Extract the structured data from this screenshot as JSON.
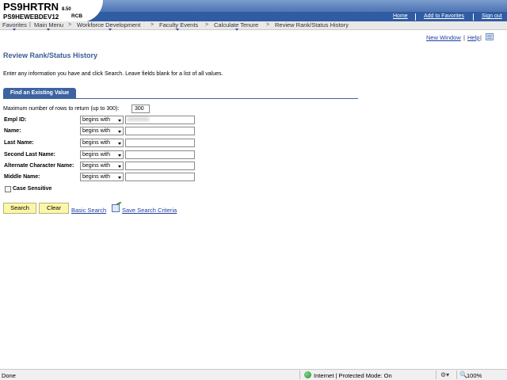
{
  "header": {
    "system": "PS9HRTRN",
    "version": "8.50",
    "database": "PS9HEWEBDEV12",
    "user": "RCB",
    "links": [
      "Home",
      "Add to Favorites",
      "Sign out"
    ]
  },
  "nav": {
    "items": [
      "Favorites",
      "Main Menu",
      "Workforce Development",
      "Faculty Events",
      "Calculate Tenure",
      "Review Rank/Status History"
    ],
    "separator": ">"
  },
  "page_links": {
    "new_window": "New Window",
    "help": "Help"
  },
  "page": {
    "title": "Review Rank/Status History",
    "instructions": "Enter any information you have and click Search. Leave fields blank for a list of all values.",
    "tab": "Find an Existing Value",
    "max_rows_label": "Maximum number of rows to return (up to 300):",
    "max_rows_value": "300"
  },
  "fields": [
    {
      "label": "Empl ID:",
      "operator": "begins with",
      "value": "0000000"
    },
    {
      "label": "Name:",
      "operator": "begins with",
      "value": ""
    },
    {
      "label": "Last Name:",
      "operator": "begins with",
      "value": ""
    },
    {
      "label": "Second Last Name:",
      "operator": "begins with",
      "value": ""
    },
    {
      "label": "Alternate Character Name:",
      "operator": "begins with",
      "value": ""
    },
    {
      "label": "Middle Name:",
      "operator": "begins with",
      "value": ""
    }
  ],
  "case_sensitive_label": "Case Sensitive",
  "buttons": {
    "search": "Search",
    "clear": "Clear",
    "basic_search": "Basic Search",
    "save_criteria": "Save Search Criteria"
  },
  "statusbar": {
    "done": "Done",
    "zone": "Internet | Protected Mode: On",
    "zoom": "100%"
  },
  "colors": {
    "accent": "#3d63a1",
    "button": "#fbf7a8",
    "link": "#2040a0"
  }
}
